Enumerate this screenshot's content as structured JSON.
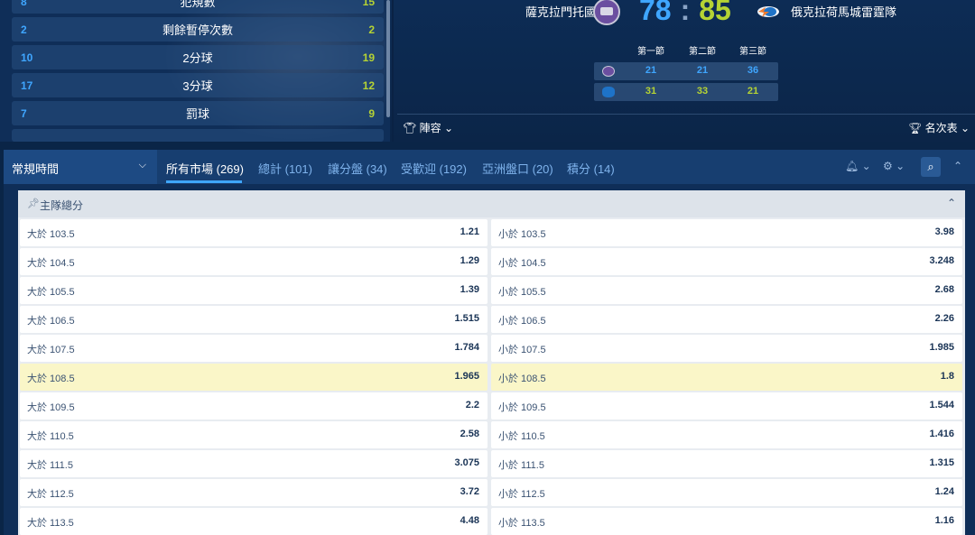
{
  "stats": [
    {
      "left": "8",
      "label": "犯規數",
      "right": "15"
    },
    {
      "left": "2",
      "label": "剩餘暫停次數",
      "right": "2"
    },
    {
      "left": "10",
      "label": "2分球",
      "right": "19"
    },
    {
      "left": "17",
      "label": "3分球",
      "right": "12"
    },
    {
      "left": "7",
      "label": "罰球",
      "right": "9"
    }
  ],
  "match": {
    "home_team": "薩克拉門托國王隊",
    "away_team": "俄克拉荷馬城雷霆隊",
    "home_score": "78",
    "away_score": "85",
    "separator": ":",
    "quarter_headers": [
      "第一節",
      "第二節",
      "第三節"
    ],
    "home_quarters": [
      "21",
      "21",
      "36"
    ],
    "away_quarters": [
      "31",
      "33",
      "21"
    ],
    "lineup_label": "陣容",
    "standings_label": "名次表"
  },
  "nav": {
    "period": "常規時間",
    "tabs": [
      "所有市場 (269)",
      "總計 (101)",
      "讓分盤 (34)",
      "受歡迎 (192)",
      "亞洲盤口 (20)",
      "積分 (14)"
    ]
  },
  "market": {
    "title": "主隊總分",
    "rows": [
      {
        "over": "大於 103.5",
        "over_price": "1.21",
        "under": "小於 103.5",
        "under_price": "3.98"
      },
      {
        "over": "大於 104.5",
        "over_price": "1.29",
        "under": "小於 104.5",
        "under_price": "3.248"
      },
      {
        "over": "大於 105.5",
        "over_price": "1.39",
        "under": "小於 105.5",
        "under_price": "2.68"
      },
      {
        "over": "大於 106.5",
        "over_price": "1.515",
        "under": "小於 106.5",
        "under_price": "2.26"
      },
      {
        "over": "大於 107.5",
        "over_price": "1.784",
        "under": "小於 107.5",
        "under_price": "1.985"
      },
      {
        "over": "大於 108.5",
        "over_price": "1.965",
        "under": "小於 108.5",
        "under_price": "1.8"
      },
      {
        "over": "大於 109.5",
        "over_price": "2.2",
        "under": "小於 109.5",
        "under_price": "1.544"
      },
      {
        "over": "大於 110.5",
        "over_price": "2.58",
        "under": "小於 110.5",
        "under_price": "1.416"
      },
      {
        "over": "大於 111.5",
        "over_price": "3.075",
        "under": "小於 111.5",
        "under_price": "1.315"
      },
      {
        "over": "大於 112.5",
        "over_price": "3.72",
        "under": "小於 112.5",
        "under_price": "1.24"
      },
      {
        "over": "大於 113.5",
        "over_price": "4.48",
        "under": "小於 113.5",
        "under_price": "1.16"
      }
    ]
  },
  "colors": {
    "home_accent": "#3fa6ff",
    "away_accent": "#b5d334",
    "highlight_row": "#faf6c8"
  }
}
